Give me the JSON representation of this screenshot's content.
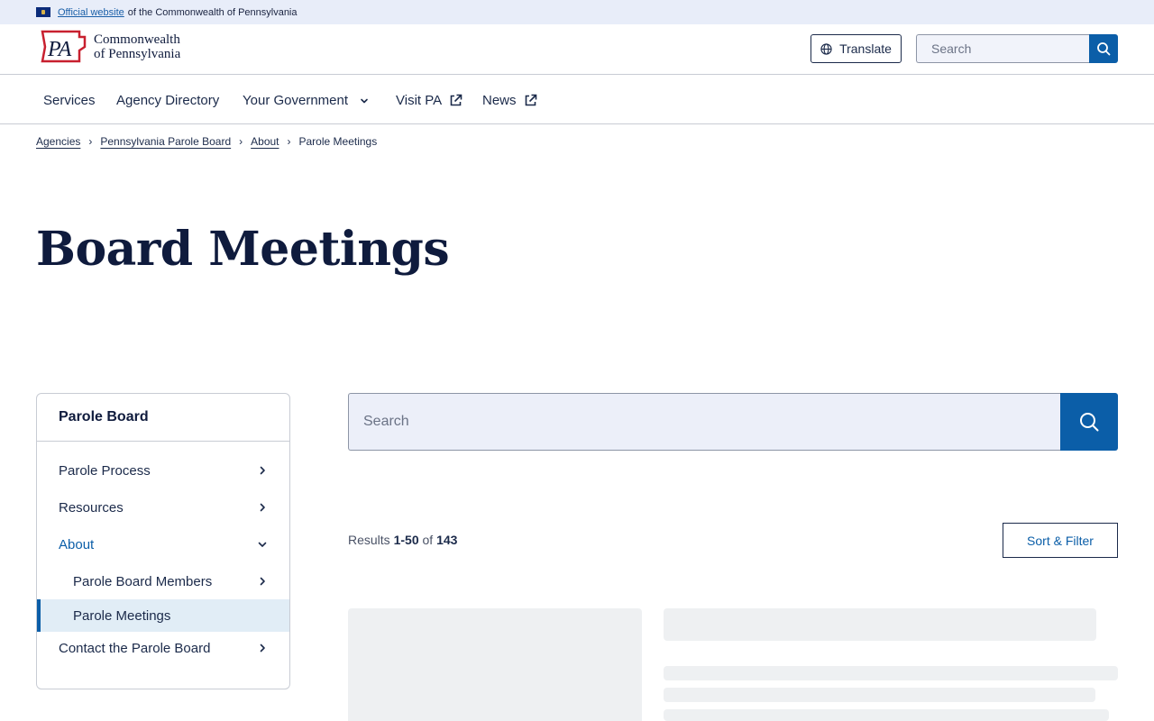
{
  "banner": {
    "official_link": "Official website",
    "official_text": "of the Commonwealth of Pennsylvania"
  },
  "header": {
    "logo_line1": "Commonwealth",
    "logo_line2": "of Pennsylvania",
    "logo_mark": "PA",
    "translate_label": "Translate",
    "search_placeholder": "Search"
  },
  "nav": {
    "items": [
      {
        "label": "Services"
      },
      {
        "label": "Agency Directory"
      },
      {
        "label": "Your Government",
        "icon": "chevron-down-icon"
      },
      {
        "label": "Visit PA",
        "icon": "external-link-icon"
      },
      {
        "label": "News",
        "icon": "external-link-icon"
      }
    ]
  },
  "breadcrumb": {
    "items": [
      "Agencies",
      "Pennsylvania Parole Board",
      "About"
    ],
    "current": "Parole Meetings"
  },
  "page": {
    "title": "Board Meetings"
  },
  "sidebar": {
    "heading": "Parole Board",
    "items": [
      {
        "label": "Parole Process"
      },
      {
        "label": "Resources"
      },
      {
        "label": "About"
      },
      {
        "label": "Parole Board Members"
      },
      {
        "label": "Parole Meetings"
      },
      {
        "label": "Contact the Parole Board"
      }
    ]
  },
  "main": {
    "search_placeholder": "Search",
    "results_prefix": "Results",
    "results_range": "1-50",
    "results_of": "of",
    "results_total": "143",
    "sort_filter_label": "Sort & Filter"
  },
  "colors": {
    "accent": "#0b5ea8",
    "navy": "#0f1b3d",
    "banner_bg": "#e8edf9",
    "sidebar_current_bg": "#e1edf6"
  }
}
